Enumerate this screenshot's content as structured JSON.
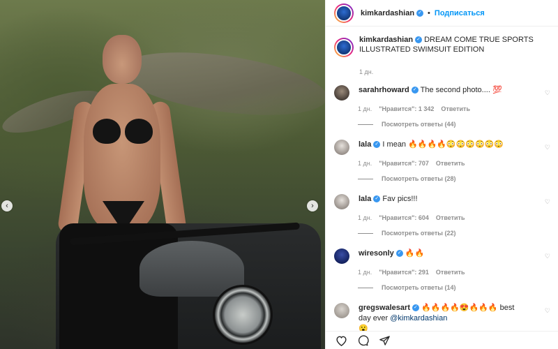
{
  "header": {
    "username": "kimkardashian",
    "follow_label": "Подписаться"
  },
  "caption": {
    "username": "kimkardashian",
    "text": "DREAM COME TRUE SPORTS ILLUSTRATED SWIMSUIT EDITION",
    "time": "1 дн."
  },
  "comments": [
    {
      "username": "sarahrhoward",
      "verified": true,
      "text": "The second photo.... 💯",
      "time": "1 дн.",
      "likes": "\"Нравится\": 1 342",
      "reply_label": "Ответить",
      "view_replies": "Посмотреть ответы (44)"
    },
    {
      "username": "lala",
      "verified": true,
      "text": "I mean 🔥🔥🔥🔥😳😳😳😳😳😳",
      "time": "1 дн.",
      "likes": "\"Нравится\": 707",
      "reply_label": "Ответить",
      "view_replies": "Посмотреть ответы (28)"
    },
    {
      "username": "lala",
      "verified": true,
      "text": "Fav pics!!!",
      "time": "1 дн.",
      "likes": "\"Нравится\": 604",
      "reply_label": "Ответить",
      "view_replies": "Посмотреть ответы (22)"
    },
    {
      "username": "wiresonly",
      "verified": true,
      "text": "🔥🔥",
      "time": "1 дн.",
      "likes": "\"Нравится\": 291",
      "reply_label": "Ответить",
      "view_replies": "Посмотреть ответы (14)"
    },
    {
      "username": "gregswalesart",
      "verified": true,
      "text": "🔥🔥🔥🔥😍🔥🔥🔥 best day ever ",
      "mention": "@kimkardashian",
      "text_end": "😮"
    }
  ],
  "colors": {
    "accent": "#0095f6",
    "verified": "#3897f0",
    "muted": "#8e8e8e",
    "text": "#262626"
  },
  "icons": {
    "like": "heart-icon",
    "comment": "comment-icon",
    "share": "share-icon",
    "prev": "chevron-left-icon",
    "next": "chevron-right-icon"
  }
}
